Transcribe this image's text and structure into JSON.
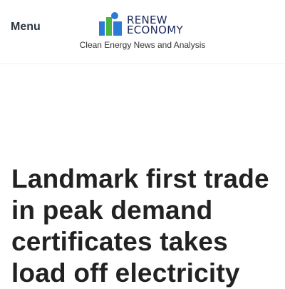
{
  "header": {
    "menu_label": "Menu",
    "logo": {
      "line1": "RENEW",
      "line2": "ECONOMY",
      "colors": {
        "blue": "#2a7ad6",
        "green": "#4bb543",
        "navy": "#1d2a5c"
      }
    },
    "tagline": "Clean Energy News and Analysis"
  },
  "article": {
    "title": "Landmark first trade in peak demand certificates takes load off electricity"
  }
}
